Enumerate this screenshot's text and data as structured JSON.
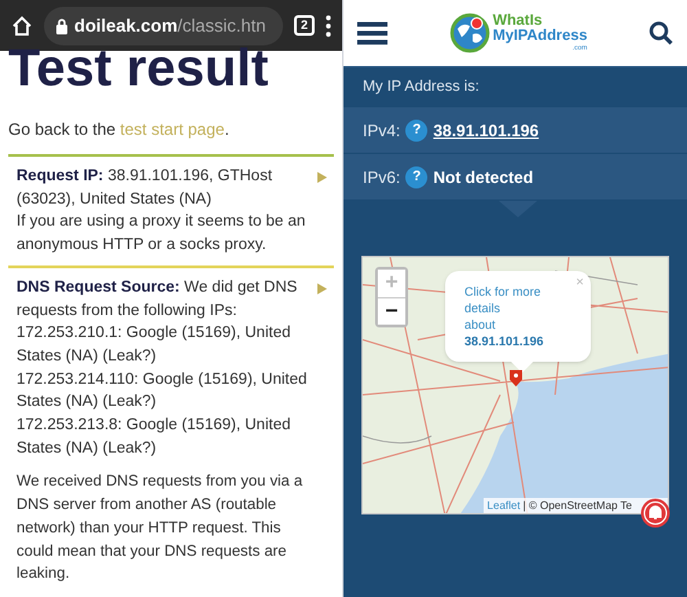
{
  "browser": {
    "url_domain": "doileak.com",
    "url_path": "/classic.htn",
    "tab_count": "2"
  },
  "doileak": {
    "title": "Test result",
    "back_text": "Go back to the ",
    "back_link": "test start page",
    "back_end": ".",
    "results": [
      {
        "label": "Request IP:",
        "lines": [
          "38.91.101.196, GTHost (63023), United States (NA)",
          "If you are using a proxy it seems to be an anonymous HTTP or a socks proxy."
        ]
      },
      {
        "label": "DNS Request Source:",
        "lines": [
          "We did get DNS requests from the following IPs:",
          "172.253.210.1: Google (15169), United States (NA) (Leak?)",
          "172.253.214.110: Google (15169), United States (NA) (Leak?)",
          "172.253.213.8: Google (15169), United States (NA) (Leak?)"
        ],
        "note": "We received DNS requests from you via a DNS server from another AS (routable network) than your HTTP request. This could mean that your DNS requests are leaking."
      }
    ]
  },
  "whatismyip": {
    "logo": {
      "line1": "WhatIs",
      "line2": "MyIPAddress",
      "line3": ".com"
    },
    "ip_label": "My IP Address is:",
    "rows": [
      {
        "label": "IPv4:",
        "help": "?",
        "value": "38.91.101.196",
        "link": true
      },
      {
        "label": "IPv6:",
        "help": "?",
        "value": "Not detected",
        "link": false
      }
    ],
    "map": {
      "zoom_buttons": [
        {
          "label": "+",
          "disabled": true
        },
        {
          "label": "−",
          "disabled": false
        }
      ],
      "popup": {
        "close": "×",
        "lines": [
          "Click for more",
          "details",
          "about"
        ],
        "ip": "38.91.101.196"
      },
      "attribution_link": "Leaflet",
      "attribution_text": "| © OpenStreetMap Te"
    }
  }
}
